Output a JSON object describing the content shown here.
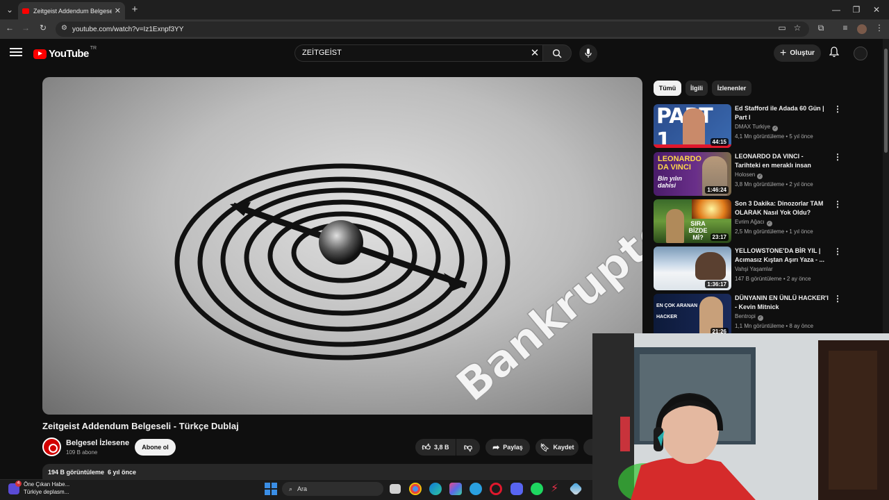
{
  "browser": {
    "tab_title": "Zeitgeist Addendum Belgeseli -",
    "url": "youtube.com/watch?v=Iz1Exnpf3YY"
  },
  "header": {
    "logo_text": "YouTube",
    "country_code": "TR",
    "search_value": "ZEİTGEİST",
    "create_label": "Oluştur"
  },
  "video": {
    "frame_text": "Bankruptcy",
    "title": "Zeitgeist Addendum Belgeseli - Türkçe Dublaj",
    "channel": "Belgesel İzlesene",
    "subscribers": "109 B abone",
    "subscribe_label": "Abone ol",
    "likes": "3,8 B",
    "share_label": "Paylaş",
    "save_label": "Kaydet",
    "views": "194 B görüntüleme",
    "age": "6 yıl önce"
  },
  "sidebar": {
    "chips": [
      "Tümü",
      "İlgili",
      "İzlenenler"
    ],
    "items": [
      {
        "title": "Ed Stafford ile Adada 60 Gün | Part I",
        "channel": "DMAX Turkiye",
        "views": "4,1 Mn görüntüleme",
        "age": "5 yıl önce",
        "duration": "44:15",
        "thumb_text": "PART 1"
      },
      {
        "title": "LEONARDO DA VINCI - Tarihteki en meraklı insan (Biyografi ...",
        "channel": "Holosen",
        "views": "3,8 Mn görüntüleme",
        "age": "2 yıl önce",
        "duration": "1:46:24",
        "thumb_text": "LEONARDO DA VINCI"
      },
      {
        "title": "Son 3 Dakika: Dinozorlar TAM OLARAK Nasıl Yok Oldu?",
        "channel": "Evrim Ağacı",
        "views": "2,5 Mn görüntüleme",
        "age": "1 yıl önce",
        "duration": "23:17",
        "thumb_text": "SIRA BİZDE Mİ?"
      },
      {
        "title": "YELLOWSTONE'DA BİR YIL | Acımasız Kıştan Aşırı Yaza - ...",
        "channel": "Vahşi Yaşamlar",
        "views": "147 B görüntüleme",
        "age": "2 ay önce",
        "duration": "1:36:17",
        "thumb_text": ""
      },
      {
        "title": "DÜNYANIN EN ÜNLÜ HACKER'I - Kevin Mitnick",
        "channel": "Bentropi",
        "views": "1,1 Mn görüntüleme",
        "age": "8 ay önce",
        "duration": "21:26",
        "thumb_text": "EN ÇOK ARANAN HACKER"
      }
    ]
  },
  "taskbar": {
    "news_title": "Öne Çıkan Habe...",
    "news_sub": "Türkiye deplasm...",
    "news_badge": "4",
    "search_placeholder": "Ara"
  }
}
